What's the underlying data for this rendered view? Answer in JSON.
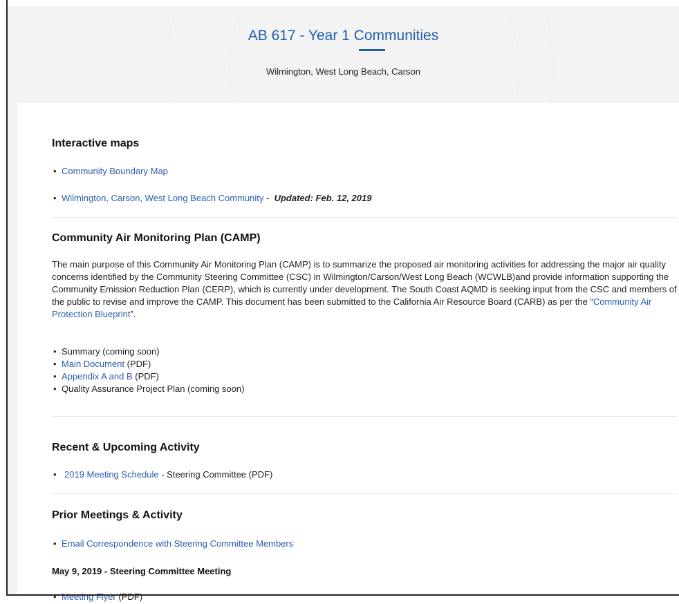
{
  "header": {
    "title": "AB 617 - Year 1 Communities",
    "subtitle": "Wilmington, West Long Beach, Carson"
  },
  "interactive_maps": {
    "heading": "Interactive maps",
    "items": [
      {
        "link": "Community Boundary Map"
      },
      {
        "link": "Wilmington, Carson, West Long Beach Community",
        "sep": " - ",
        "note": "Updated: Feb. 12, 2019"
      }
    ]
  },
  "camp": {
    "heading": "Community Air Monitoring Plan (CAMP)",
    "paragraph": {
      "before": "The main purpose of this Community Air Monitoring Plan (CAMP) is to summarize the proposed air monitoring activities for addressing the major air quality concerns identified by the Community Steering Committee (CSC) in Wilmington/Carson/West Long Beach (WCWLB)and provide information supporting the Community Emission Reduction Plan (CERP), which is currently under development. The South Coast AQMD is seeking input from the CSC and members of the public to revise and improve the CAMP. This document has been submitted to the California Air Resource Board (CARB) as per the “",
      "link": "Community Air Protection Blueprint",
      "after": "”."
    },
    "items": [
      {
        "text": "Summary (coming soon)"
      },
      {
        "link": "Main Document",
        "text": " (PDF)"
      },
      {
        "link": "Appendix A and B",
        "text": " (PDF)"
      },
      {
        "text": "Quality Assurance Project Plan (coming soon)"
      }
    ]
  },
  "recent": {
    "heading": "Recent & Upcoming Activity",
    "items": [
      {
        "link": "2019 Meeting Schedule",
        "text": " - Steering Committee (PDF)"
      }
    ]
  },
  "prior": {
    "heading": "Prior Meetings & Activity",
    "items": [
      {
        "link": "Email Correspondence with Steering Committee Members"
      }
    ],
    "meeting": {
      "heading": "May 9, 2019 - Steering Committee Meeting",
      "items": [
        {
          "link": "Meeting Flyer",
          "text": " (PDF)"
        }
      ]
    }
  },
  "bullet": "•"
}
